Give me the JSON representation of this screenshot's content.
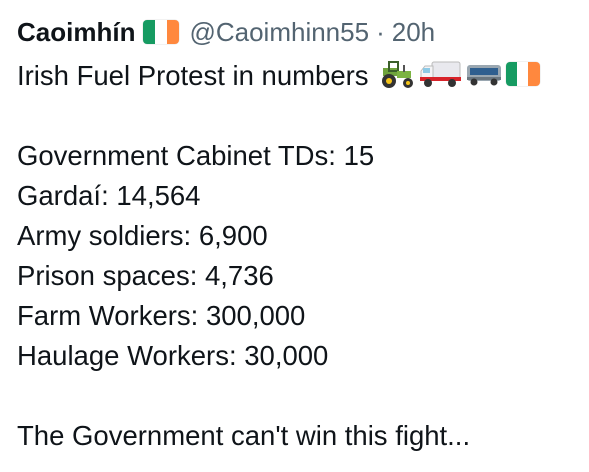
{
  "tweet": {
    "display_name": "Caoimhín",
    "handle": "@Caoimhinn55",
    "separator": "·",
    "time": "20h",
    "flag_colors": [
      "#169b62",
      "#ffffff",
      "#ff883e"
    ],
    "title_line": "Irish Fuel Protest in numbers",
    "title_emojis": [
      "tractor-icon",
      "delivery-truck-icon",
      "bus-icon",
      "ireland-flag-icon"
    ],
    "stats": [
      "Government Cabinet TDs: 15",
      "Gardaí: 14,564",
      "Army soldiers: 6,900",
      "Prison spaces: 4,736",
      "Farm Workers: 300,000",
      "Haulage Workers: 30,000"
    ],
    "closing_line": "The Government can't win this fight..."
  }
}
